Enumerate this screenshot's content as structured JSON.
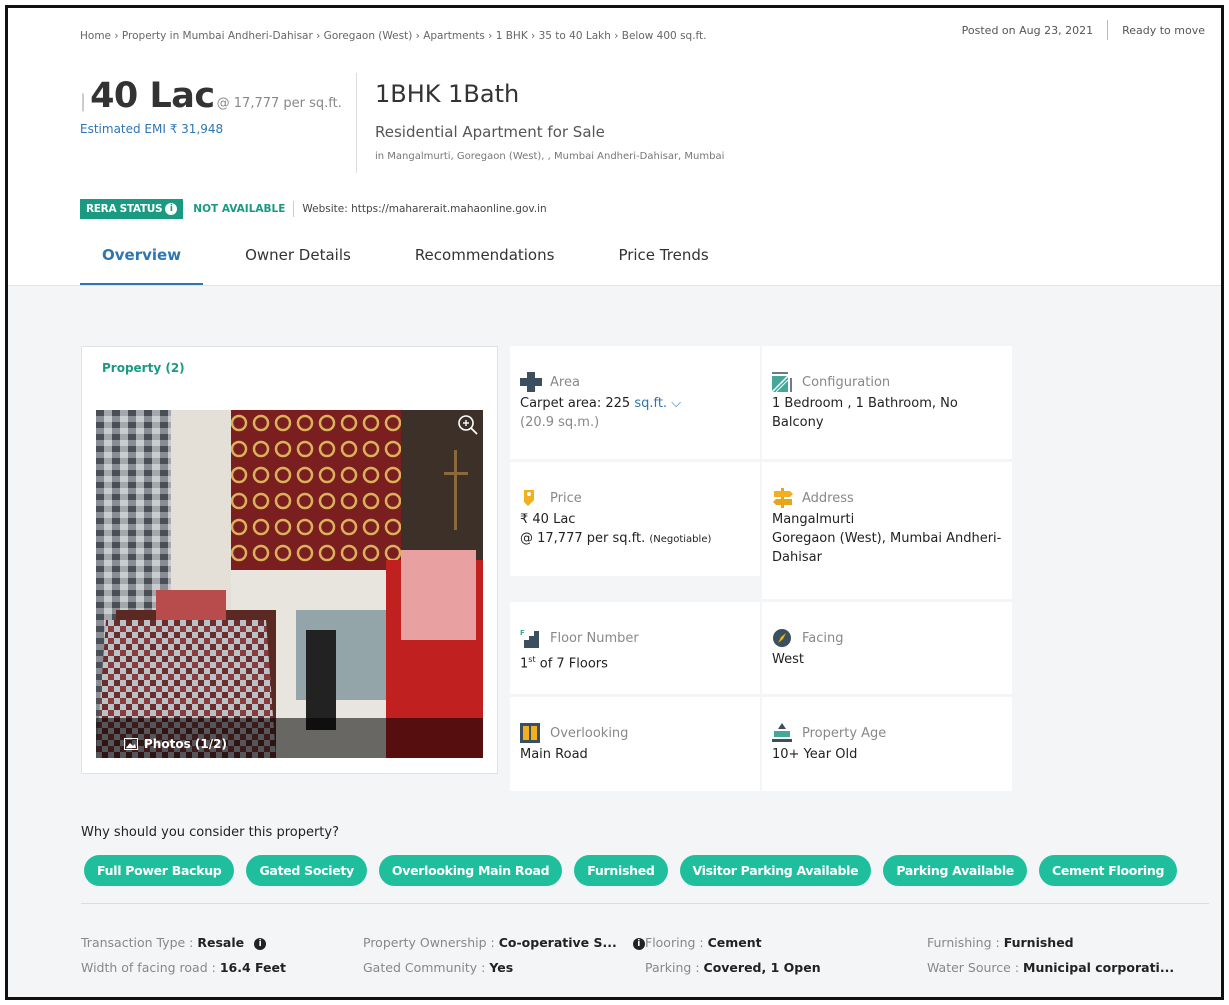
{
  "breadcrumb": "Home › Property in Mumbai Andheri-Dahisar › Goregaon (West) › Apartments › 1 BHK › 35 to 40 Lakh › Below 400 sq.ft.",
  "posted": {
    "date": "Posted on Aug 23, 2021",
    "status": "Ready to move"
  },
  "price": {
    "amount": "40 Lac",
    "per_sqft": "@ 17,777 per sq.ft.",
    "emi": "Estimated EMI ₹ 31,948"
  },
  "listing": {
    "title": "1BHK 1Bath",
    "subtitle": "Residential Apartment for Sale",
    "location": "in Mangalmurti, Goregaon (West), , Mumbai Andheri-Dahisar, Mumbai"
  },
  "rera": {
    "badge": "RERA STATUS",
    "status": "NOT AVAILABLE",
    "website": "Website: https://maharerait.mahaonline.gov.in"
  },
  "tabs": [
    {
      "label": "Overview",
      "active": true
    },
    {
      "label": "Owner Details",
      "active": false
    },
    {
      "label": "Recommendations",
      "active": false
    },
    {
      "label": "Price Trends",
      "active": false
    }
  ],
  "photos": {
    "tab_label": "Property (2)",
    "counter": "Photos (1/2)"
  },
  "details": {
    "area": {
      "label": "Area",
      "carpet_prefix": "Carpet area: 225",
      "unit": "sq.ft.",
      "alt": "(20.9 sq.m.)"
    },
    "configuration": {
      "label": "Configuration",
      "value_line1": "1 Bedroom , 1 Bathroom, No",
      "value_line2": "Balcony"
    },
    "price": {
      "label": "Price",
      "value": "₹ 40 Lac",
      "per_sqft": "@ 17,777 per sq.ft.",
      "negotiable": "(Negotiable)"
    },
    "address": {
      "label": "Address",
      "line1": "Mangalmurti",
      "line2": "Goregaon (West), Mumbai Andheri-",
      "line3": "Dahisar"
    },
    "floor": {
      "label": "Floor Number",
      "num": "1",
      "sup": "st",
      "rest": "of 7 Floors"
    },
    "facing": {
      "label": "Facing",
      "value": "West"
    },
    "overlooking": {
      "label": "Overlooking",
      "value": "Main Road"
    },
    "age": {
      "label": "Property Age",
      "value": "10+ Year Old"
    }
  },
  "why": {
    "title": "Why should you consider this property?",
    "chips": [
      "Full Power Backup",
      "Gated Society",
      "Overlooking Main Road",
      "Furnished",
      "Visitor Parking Available",
      "Parking Available",
      "Cement Flooring"
    ]
  },
  "attributes": {
    "transaction_type": {
      "k": "Transaction Type :",
      "v": "Resale"
    },
    "ownership": {
      "k": "Property Ownership :",
      "v": "Co-operative S..."
    },
    "flooring": {
      "k": "Flooring :",
      "v": "Cement"
    },
    "furnishing": {
      "k": "Furnishing :",
      "v": "Furnished"
    },
    "road_width": {
      "k": "Width of facing road :",
      "v": "16.4 Feet"
    },
    "gated": {
      "k": "Gated Community :",
      "v": "Yes"
    },
    "parking": {
      "k": "Parking :",
      "v": "Covered, 1 Open"
    },
    "water": {
      "k": "Water Source :",
      "v": "Municipal corporati..."
    }
  },
  "colors": {
    "accent_blue": "#2e75b6",
    "teal": "#1a9a80",
    "chip": "#1fbf9e"
  }
}
